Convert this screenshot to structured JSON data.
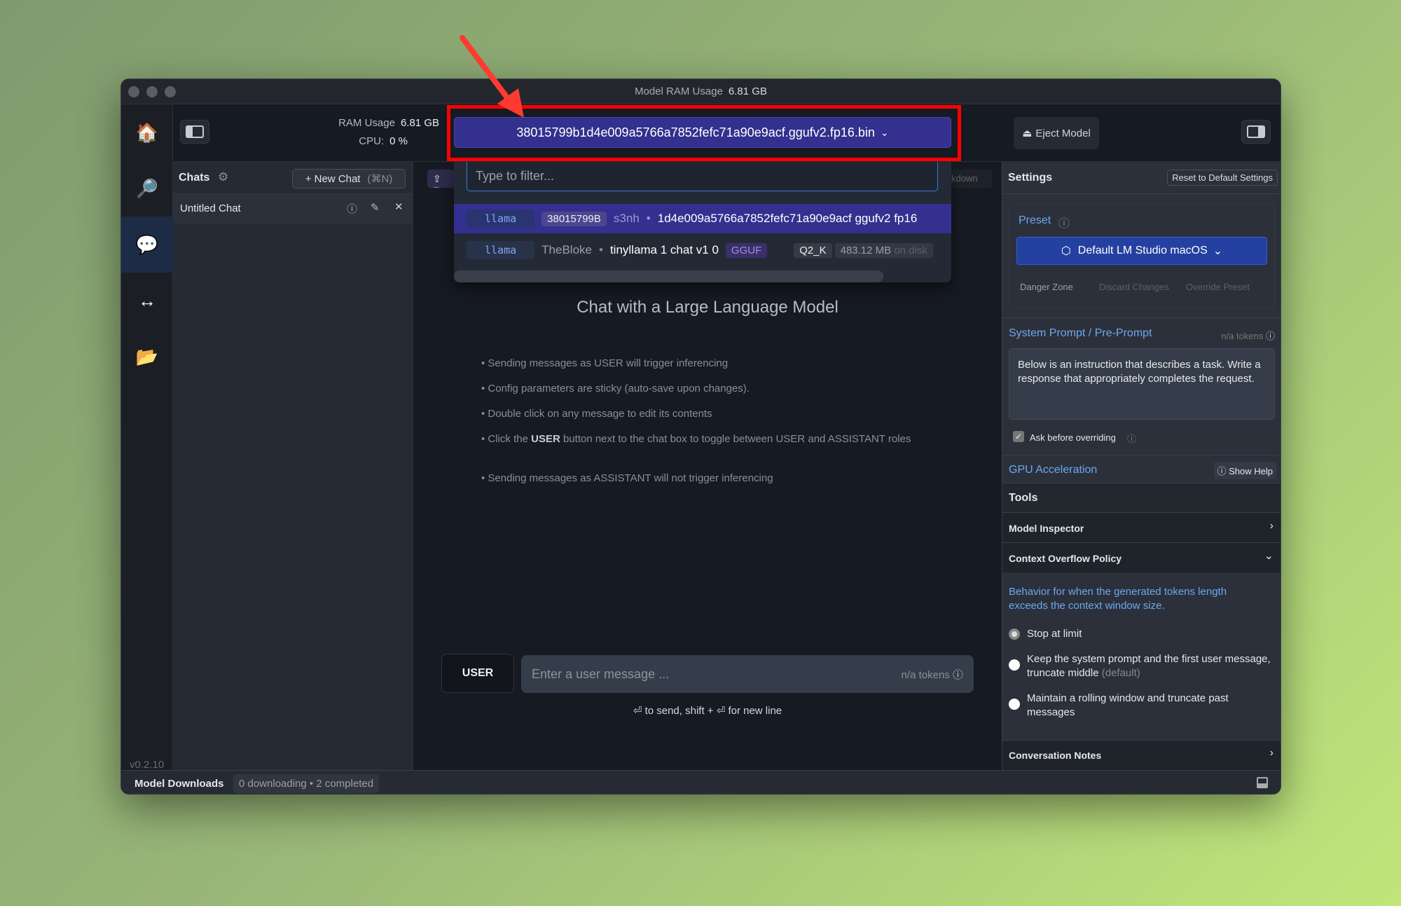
{
  "window": {
    "title_label": "Model RAM Usage",
    "title_value": "6.81 GB"
  },
  "toolbar": {
    "ram_label": "RAM Usage",
    "ram_value": "6.81 GB",
    "cpu_label": "CPU:",
    "cpu_value": "0 %",
    "model_selected": "38015799b1d4e009a5766a7852fefc71a90e9acf.ggufv2.fp16.bin",
    "eject_label": "Eject Model",
    "export_label": "E",
    "markdown_partial": "kdown"
  },
  "rail": {
    "items": [
      {
        "icon": "home-icon",
        "glyph": "🏠"
      },
      {
        "icon": "search-icon",
        "glyph": "🔎"
      },
      {
        "icon": "chat-icon",
        "glyph": "💬"
      },
      {
        "icon": "arrows-icon",
        "glyph": "↔"
      },
      {
        "icon": "folder-icon",
        "glyph": "📂"
      }
    ],
    "version": "v0.2.10"
  },
  "chats": {
    "title": "Chats",
    "new_chat": "+ New Chat",
    "new_chat_shortcut": "(⌘N)",
    "items": [
      {
        "label": "Untitled Chat"
      }
    ]
  },
  "dropdown": {
    "filter_placeholder": "Type to filter...",
    "rows": [
      {
        "arch": "llama",
        "id": "38015799B",
        "author": "s3nh",
        "name": "1d4e009a5766a7852fefc71a90e9acf ggufv2 fp16"
      },
      {
        "arch": "llama",
        "author": "TheBloke",
        "name": "tinyllama 1 chat v1 0",
        "format": "GGUF",
        "quant": "Q2_K",
        "size": "483.12 MB",
        "size_suffix": "on disk"
      }
    ]
  },
  "main": {
    "heading": "Chat with a Large Language Model",
    "hints": [
      "• Sending messages as USER will trigger inferencing",
      "• Config parameters are sticky (auto-save upon changes).",
      "• Double click on any message to edit its contents"
    ],
    "hint4_pre": "• Click the ",
    "hint4_bold": "USER",
    "hint4_post": " button next to the chat box to toggle between USER and ASSISTANT roles",
    "hint5": "• Sending messages as ASSISTANT will not trigger inferencing",
    "role_button": "USER",
    "input_placeholder": "Enter a user message ...",
    "tokens": "n/a tokens",
    "send_hint": "⏎ to send, shift + ⏎ for new line"
  },
  "settings": {
    "title": "Settings",
    "reset": "Reset to Default Settings",
    "preset_label": "Preset",
    "preset_value": "Default LM Studio macOS",
    "danger_zone": "Danger Zone",
    "discard": "Discard Changes",
    "override": "Override Preset",
    "system_prompt_label": "System Prompt / Pre-Prompt",
    "system_prompt_tokens": "n/a tokens",
    "system_prompt": "Below is an instruction that describes a task. Write a response that appropriately completes the request.",
    "ask_before": "Ask before overriding",
    "ask_before_checked": true,
    "gpu": "GPU Acceleration",
    "show_help": "Show Help",
    "tools": "Tools",
    "model_inspector": "Model Inspector",
    "context_overflow": "Context Overflow Policy",
    "overflow_desc": "Behavior for when the generated tokens length exceeds the context window size.",
    "options": [
      {
        "label": "Stop at limit",
        "selected": true
      },
      {
        "label": "Keep the system prompt and the first user message, truncate middle",
        "suffix": "(default)",
        "selected": false
      },
      {
        "label": "Maintain a rolling window and truncate past messages",
        "selected": false
      }
    ],
    "conversation_notes": "Conversation Notes"
  },
  "bottom": {
    "label": "Model Downloads",
    "downloading": "0 downloading",
    "completed": "2 completed"
  },
  "colors": {
    "accent_selector": "#34308f",
    "preset_blue": "#2440a0",
    "highlight": "#ff0000"
  }
}
